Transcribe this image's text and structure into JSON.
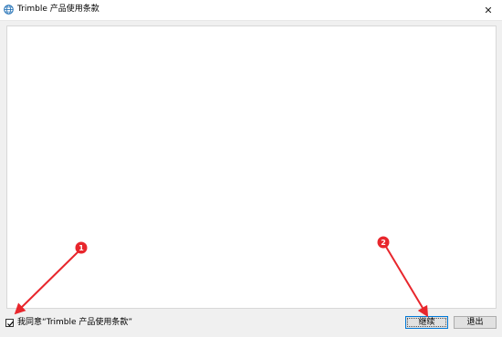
{
  "window": {
    "title": "Trimble 产品使用条款",
    "close_glyph": "✕"
  },
  "agreement": {
    "checkbox_checked": true,
    "label": "我同意“Trimble 产品使用条款”"
  },
  "buttons": {
    "continue_label": "继续",
    "exit_label": "退出"
  },
  "annotations": {
    "badge_1": "1",
    "badge_2": "2",
    "color": "#e8262c"
  }
}
